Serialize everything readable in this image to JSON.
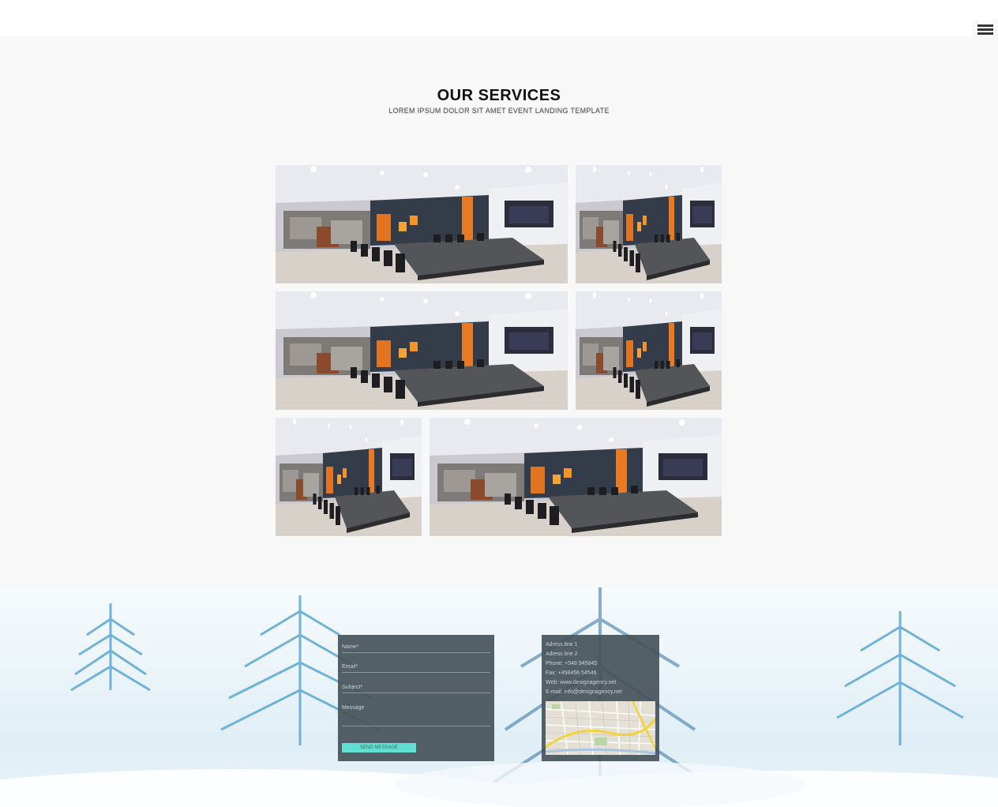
{
  "header": {
    "menu_icon": "hamburger-menu-icon"
  },
  "services": {
    "title": "OUR SERVICES",
    "subtitle": "LOREM IPSUM DOLOR SIT AMET EVENT LANDING TEMPLATE",
    "gallery_image": "conference-room-photo"
  },
  "contact_form": {
    "name_label": "Name*",
    "email_label": "Email*",
    "subject_label": "Subject*",
    "message_label": "Message",
    "send_label": "SEND MESSAGE"
  },
  "contact_info": {
    "address1": "Adress line 1",
    "address2": "Adress line 2",
    "phone": "Phone: +548 945845",
    "fax": "Fax: +458456 54546",
    "web": "Web: www.designagency.net",
    "email": "E-mail: info@designagency.net",
    "map_image": "city-map-image"
  },
  "colors": {
    "accent": "#5fe0d2",
    "panel": "#46525a",
    "section_bg": "#f7f8f7"
  }
}
